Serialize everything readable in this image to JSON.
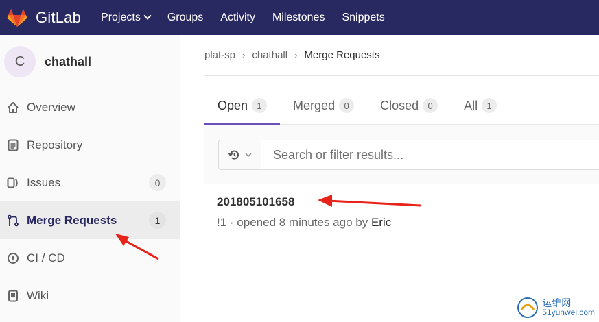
{
  "app": {
    "brand": "GitLab"
  },
  "topnav": [
    {
      "label": "Projects",
      "dropdown": true
    },
    {
      "label": "Groups"
    },
    {
      "label": "Activity"
    },
    {
      "label": "Milestones"
    },
    {
      "label": "Snippets"
    }
  ],
  "project": {
    "avatar_letter": "C",
    "name": "chathall"
  },
  "sidebar": {
    "items": [
      {
        "label": "Overview",
        "icon": "home-icon"
      },
      {
        "label": "Repository",
        "icon": "document-icon"
      },
      {
        "label": "Issues",
        "icon": "issues-icon",
        "count": "0"
      },
      {
        "label": "Merge Requests",
        "icon": "merge-request-icon",
        "count": "1",
        "active": true
      },
      {
        "label": "CI / CD",
        "icon": "rocket-icon"
      },
      {
        "label": "Wiki",
        "icon": "book-icon"
      }
    ]
  },
  "breadcrumb": [
    "plat-sp",
    "chathall",
    "Merge Requests"
  ],
  "tabs": [
    {
      "label": "Open",
      "count": "1",
      "active": true
    },
    {
      "label": "Merged",
      "count": "0"
    },
    {
      "label": "Closed",
      "count": "0"
    },
    {
      "label": "All",
      "count": "1"
    }
  ],
  "filter": {
    "placeholder": "Search or filter results..."
  },
  "merge_requests": [
    {
      "title": "201805101658",
      "ref": "!1",
      "opened": " · opened 8 minutes ago by ",
      "author": "Eric"
    }
  ],
  "watermark": {
    "text": "运维网",
    "text2": "51yunwei.com"
  },
  "colors": {
    "topbar": "#292961",
    "accent": "#6b4fbb",
    "annotation_arrow": "#e8241a"
  }
}
